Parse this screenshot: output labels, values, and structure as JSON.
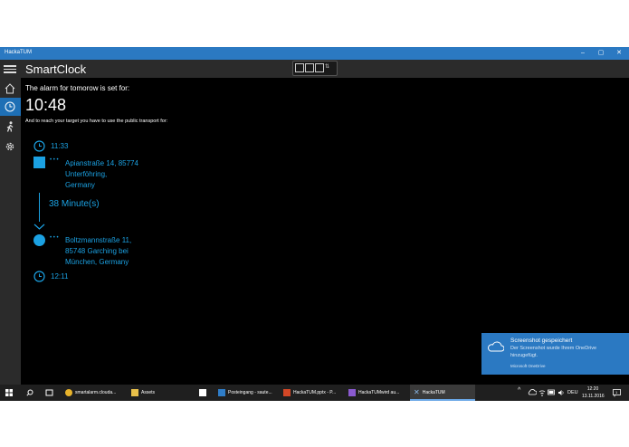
{
  "window": {
    "title": "HackaTUM",
    "controls": [
      "–",
      "▢",
      "✕"
    ]
  },
  "app": {
    "name": "SmartClock"
  },
  "devtools": {
    "icons": [
      "select-element-icon",
      "display-layout-icon",
      "inspect-icon",
      "toggle-icon"
    ]
  },
  "sidebar": {
    "items": [
      {
        "name": "home",
        "icon": "home-icon"
      },
      {
        "name": "alarm",
        "icon": "clock-icon"
      },
      {
        "name": "walk",
        "icon": "walking-person-icon"
      },
      {
        "name": "settings",
        "icon": "gear-icon"
      }
    ]
  },
  "content": {
    "intro": "The alarm for tomorow is set for:",
    "alarm_time": "10:48",
    "transport_text": "And to reach your target you have to use the public transport for:",
    "depart_time": "11:33",
    "origin": {
      "line1": "Apianstraße 14, 85774",
      "line2": "Unterföhring,",
      "line3": "Germany"
    },
    "dots": "• • •",
    "duration": "38 Minute(s)",
    "destination": {
      "line1": "Boltzmannstraße 11,",
      "line2": "85748 Garching bei",
      "line3": "München, Germany"
    },
    "arrive_time": "12:11"
  },
  "notification": {
    "title": "Screenshot gespeichert",
    "body1": "Der Screenshot wurde Ihrem OneDrive",
    "body2": "hinzugefügt.",
    "source": "Microsoft OneDrive"
  },
  "taskbar": {
    "items": [
      {
        "label": "smartalarm.clouda...",
        "icon": "chrome-icon"
      },
      {
        "label": "Assets",
        "icon": "folder-icon"
      },
      {
        "label": "",
        "icon": "store-icon"
      },
      {
        "label": "Posteingang - saute...",
        "icon": "outlook-icon"
      },
      {
        "label": "HackaTUM.pptx - P...",
        "icon": "powerpoint-icon"
      },
      {
        "label": "HackaTUMwird au...",
        "icon": "visual-studio-icon"
      },
      {
        "label": "HackaTUM",
        "icon": "app-icon"
      }
    ],
    "language": "DEU",
    "time": "12:20",
    "date": "13.11.2016"
  },
  "colors": {
    "accent": "#2b79c2",
    "link_blue": "#1ba1e2",
    "chrome": "#2b2b2b",
    "background": "#000000"
  }
}
